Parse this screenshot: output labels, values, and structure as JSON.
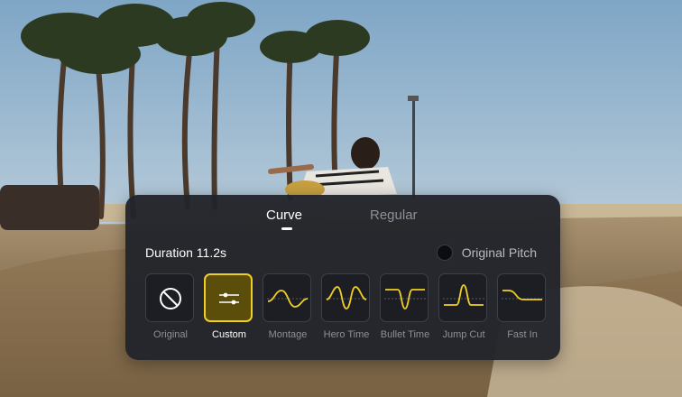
{
  "tabs": [
    {
      "label": "Curve",
      "active": true
    },
    {
      "label": "Regular",
      "active": false
    }
  ],
  "duration_label": "Duration 11.2s",
  "original_pitch": {
    "label": "Original Pitch",
    "checked": false
  },
  "presets": [
    {
      "label": "Original",
      "icon": "none-circle-slash-icon",
      "selected": false
    },
    {
      "label": "Custom",
      "icon": "sliders-icon",
      "selected": true
    },
    {
      "label": "Montage",
      "icon": "montage-curve-icon",
      "selected": false
    },
    {
      "label": "Hero Time",
      "icon": "hero-time-curve-icon",
      "selected": false
    },
    {
      "label": "Bullet Time",
      "icon": "bullet-time-curve-icon",
      "selected": false
    },
    {
      "label": "Jump Cut",
      "icon": "jump-cut-curve-icon",
      "selected": false
    },
    {
      "label": "Fast In",
      "icon": "fast-in-curve-icon",
      "selected": false
    }
  ],
  "colors": {
    "accent": "#f0cf25",
    "panel_bg": "#22242b",
    "text_primary": "#ffffff",
    "text_secondary": "#8d8f96"
  }
}
